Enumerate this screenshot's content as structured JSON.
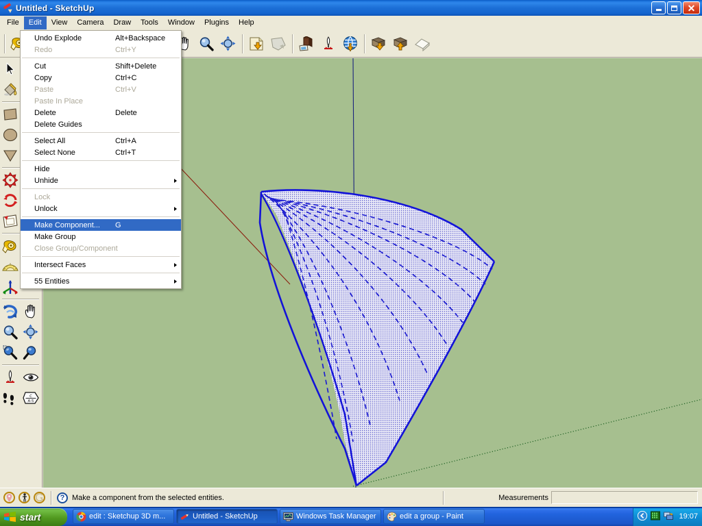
{
  "window": {
    "title": "Untitled - SketchUp",
    "app_icon": "sketchup-pencil-icon",
    "minimize_label": "Minimize",
    "maximize_label": "Restore",
    "close_label": "Close"
  },
  "menubar": {
    "items": [
      {
        "label": "File",
        "active": false
      },
      {
        "label": "Edit",
        "active": true
      },
      {
        "label": "View",
        "active": false
      },
      {
        "label": "Camera",
        "active": false
      },
      {
        "label": "Draw",
        "active": false
      },
      {
        "label": "Tools",
        "active": false
      },
      {
        "label": "Window",
        "active": false
      },
      {
        "label": "Plugins",
        "active": false
      },
      {
        "label": "Help",
        "active": false
      }
    ]
  },
  "edit_menu": {
    "rows": [
      {
        "type": "item",
        "label": "Undo Explode",
        "accel": "Alt+Backspace",
        "disabled": false,
        "highlight": false,
        "submenu": false
      },
      {
        "type": "item",
        "label": "Redo",
        "accel": "Ctrl+Y",
        "disabled": true,
        "highlight": false,
        "submenu": false
      },
      {
        "type": "separator"
      },
      {
        "type": "item",
        "label": "Cut",
        "accel": "Shift+Delete",
        "disabled": false,
        "highlight": false,
        "submenu": false
      },
      {
        "type": "item",
        "label": "Copy",
        "accel": "Ctrl+C",
        "disabled": false,
        "highlight": false,
        "submenu": false
      },
      {
        "type": "item",
        "label": "Paste",
        "accel": "Ctrl+V",
        "disabled": true,
        "highlight": false,
        "submenu": false
      },
      {
        "type": "item",
        "label": "Paste In Place",
        "accel": "",
        "disabled": true,
        "highlight": false,
        "submenu": false
      },
      {
        "type": "item",
        "label": "Delete",
        "accel": "Delete",
        "disabled": false,
        "highlight": false,
        "submenu": false
      },
      {
        "type": "item",
        "label": "Delete Guides",
        "accel": "",
        "disabled": false,
        "highlight": false,
        "submenu": false
      },
      {
        "type": "separator"
      },
      {
        "type": "item",
        "label": "Select All",
        "accel": "Ctrl+A",
        "disabled": false,
        "highlight": false,
        "submenu": false
      },
      {
        "type": "item",
        "label": "Select None",
        "accel": "Ctrl+T",
        "disabled": false,
        "highlight": false,
        "submenu": false
      },
      {
        "type": "separator"
      },
      {
        "type": "item",
        "label": "Hide",
        "accel": "",
        "disabled": false,
        "highlight": false,
        "submenu": false
      },
      {
        "type": "item",
        "label": "Unhide",
        "accel": "",
        "disabled": false,
        "highlight": false,
        "submenu": true
      },
      {
        "type": "separator"
      },
      {
        "type": "item",
        "label": "Lock",
        "accel": "",
        "disabled": true,
        "highlight": false,
        "submenu": false
      },
      {
        "type": "item",
        "label": "Unlock",
        "accel": "",
        "disabled": false,
        "highlight": false,
        "submenu": true
      },
      {
        "type": "separator"
      },
      {
        "type": "item",
        "label": "Make Component...",
        "accel": "G",
        "disabled": false,
        "highlight": true,
        "submenu": false
      },
      {
        "type": "item",
        "label": "Make Group",
        "accel": "",
        "disabled": false,
        "highlight": false,
        "submenu": false
      },
      {
        "type": "item",
        "label": "Close Group/Component",
        "accel": "",
        "disabled": true,
        "highlight": false,
        "submenu": false
      },
      {
        "type": "separator"
      },
      {
        "type": "item",
        "label": "Intersect Faces",
        "accel": "",
        "disabled": false,
        "highlight": false,
        "submenu": true
      },
      {
        "type": "separator"
      },
      {
        "type": "item",
        "label": "55 Entities",
        "accel": "",
        "disabled": false,
        "highlight": false,
        "submenu": true
      }
    ]
  },
  "toolbar_top": {
    "groups": [
      {
        "buttons": [
          {
            "icon": "tape-measure-icon",
            "tooltip": "Tape Measure"
          },
          {
            "icon": "paint-bucket-icon",
            "tooltip": "Paint Bucket"
          }
        ]
      },
      {
        "buttons": [
          {
            "icon": "push-pull-icon",
            "tooltip": "Push/Pull"
          },
          {
            "icon": "move-icon",
            "tooltip": "Move"
          },
          {
            "icon": "rotate-icon",
            "tooltip": "Rotate"
          },
          {
            "icon": "follow-me-icon",
            "tooltip": "Follow Me"
          }
        ]
      },
      {
        "buttons": [
          {
            "icon": "orbit-icon",
            "tooltip": "Orbit"
          },
          {
            "icon": "pan-hand-icon",
            "tooltip": "Pan"
          },
          {
            "icon": "zoom-magnifier-icon",
            "tooltip": "Zoom"
          },
          {
            "icon": "zoom-extents-icon",
            "tooltip": "Zoom Extents"
          }
        ]
      },
      {
        "buttons": [
          {
            "icon": "print-icon",
            "tooltip": "Print"
          },
          {
            "icon": "shadows-face-icon",
            "tooltip": "Shadows"
          }
        ]
      },
      {
        "buttons": [
          {
            "icon": "component-browser-icon",
            "tooltip": "Components"
          },
          {
            "icon": "position-camera-icon",
            "tooltip": "Position Camera"
          },
          {
            "icon": "get-models-globe-icon",
            "tooltip": "Get Models"
          }
        ]
      },
      {
        "buttons": [
          {
            "icon": "download-layout-icon",
            "tooltip": "Download"
          },
          {
            "icon": "upload-layout-icon",
            "tooltip": "Share Model"
          },
          {
            "icon": "house-outline-icon",
            "tooltip": "Photo Match"
          }
        ]
      }
    ]
  },
  "toolbar_left": {
    "rows": [
      {
        "buttons": [
          {
            "icon": "select-arrow-icon",
            "selected": false,
            "tooltip": "Select"
          }
        ]
      },
      {
        "buttons": [
          {
            "icon": "paint-bucket-icon",
            "selected": false,
            "tooltip": "Paint Bucket"
          }
        ]
      },
      {
        "separator": true
      },
      {
        "buttons": [
          {
            "icon": "rectangle-icon",
            "selected": false,
            "tooltip": "Rectangle"
          }
        ]
      },
      {
        "buttons": [
          {
            "icon": "circle-icon",
            "selected": false,
            "tooltip": "Circle"
          }
        ]
      },
      {
        "buttons": [
          {
            "icon": "polygon-icon",
            "selected": false,
            "tooltip": "Polygon"
          }
        ]
      },
      {
        "separator": true
      },
      {
        "buttons": [
          {
            "icon": "move-icon",
            "selected": false,
            "tooltip": "Move"
          }
        ]
      },
      {
        "buttons": [
          {
            "icon": "rotate-icon",
            "selected": false,
            "tooltip": "Rotate"
          }
        ]
      },
      {
        "buttons": [
          {
            "icon": "offset-icon",
            "selected": false,
            "tooltip": "Offset"
          }
        ]
      },
      {
        "separator": true
      },
      {
        "buttons": [
          {
            "icon": "tape-measure-icon",
            "selected": false,
            "tooltip": "Tape Measure"
          }
        ]
      },
      {
        "buttons": [
          {
            "icon": "protractor-icon",
            "selected": false,
            "tooltip": "Protractor"
          }
        ]
      },
      {
        "buttons": [
          {
            "icon": "axes-icon",
            "selected": false,
            "tooltip": "Axes"
          }
        ]
      },
      {
        "separator": true
      },
      {
        "buttons": [
          {
            "icon": "orbit-icon",
            "selected": false,
            "tooltip": "Orbit"
          },
          {
            "icon": "pan-hand-icon",
            "selected": false,
            "tooltip": "Pan"
          }
        ]
      },
      {
        "buttons": [
          {
            "icon": "zoom-magnifier-icon",
            "selected": false,
            "tooltip": "Zoom"
          },
          {
            "icon": "zoom-extents-icon",
            "selected": false,
            "tooltip": "Zoom Extents"
          }
        ]
      },
      {
        "buttons": [
          {
            "icon": "zoom-window-icon",
            "selected": false,
            "tooltip": "Zoom Window"
          },
          {
            "icon": "previous-view-icon",
            "selected": false,
            "tooltip": "Previous"
          }
        ]
      },
      {
        "separator": true
      },
      {
        "buttons": [
          {
            "icon": "position-camera-icon",
            "selected": false,
            "tooltip": "Position Camera"
          },
          {
            "icon": "look-around-eye-icon",
            "selected": false,
            "tooltip": "Look Around"
          }
        ]
      },
      {
        "buttons": [
          {
            "icon": "walk-footsteps-icon",
            "selected": false,
            "tooltip": "Walk"
          },
          {
            "icon": "section-plane-icon",
            "selected": false,
            "tooltip": "Section Plane"
          }
        ]
      }
    ]
  },
  "viewport": {
    "background_color": "#A6BF8F",
    "axis_red_color": "#8B2010",
    "axis_green_color": "#1B5E20",
    "axis_blue_color": "#1A237E",
    "selection_edge_color": "#1313D8",
    "face_fill_color": "#E8E8F6",
    "selection_dot_color": "#2222BB",
    "model_description": "Selected curved swept surface (55 entities) shown with blue selection highlight and dotted selection hatch"
  },
  "statusbar": {
    "geo_buttons": [
      {
        "icon": "geo-location-icon"
      },
      {
        "icon": "person-scale-icon"
      },
      {
        "icon": "solar-north-icon"
      }
    ],
    "help_icon": "question-mark-icon",
    "hint_text": "Make a component from the selected entities.",
    "measurements_label": "Measurements",
    "measurements_value": ""
  },
  "taskbar": {
    "start_label": "start",
    "start_icon": "windows-flag-icon",
    "tasks": [
      {
        "label": "edit : Sketchup 3D m...",
        "icon": "chrome-browser-icon",
        "active": false
      },
      {
        "label": "Untitled - SketchUp",
        "icon": "sketchup-pencil-icon",
        "active": true
      },
      {
        "label": "Windows Task Manager",
        "icon": "task-manager-icon",
        "active": false
      },
      {
        "label": "edit a group - Paint",
        "icon": "paint-palette-icon",
        "active": false
      }
    ],
    "tray_icons": [
      {
        "icon": "show-hidden-chevron-icon"
      },
      {
        "icon": "network-activity-icon"
      },
      {
        "icon": "system-notify-icon"
      }
    ],
    "clock": "19:07"
  }
}
